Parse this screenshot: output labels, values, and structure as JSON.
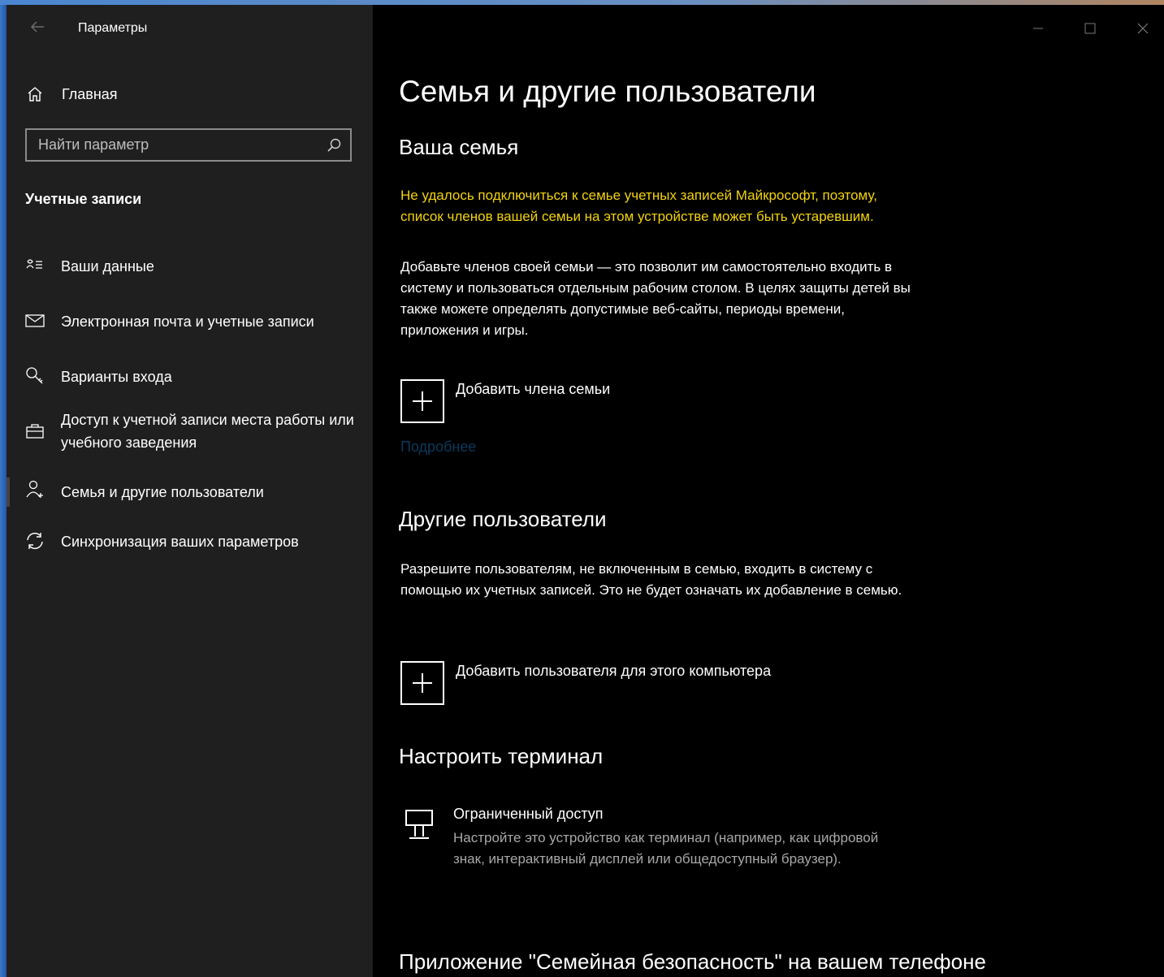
{
  "app": {
    "title": "Параметры"
  },
  "sidebar": {
    "home_label": "Главная",
    "search_placeholder": "Найти параметр",
    "section_title": "Учетные записи",
    "items": [
      {
        "label": "Ваши данные",
        "icon": "user-info-icon"
      },
      {
        "label": "Электронная почта и учетные записи",
        "icon": "mail-icon"
      },
      {
        "label": "Варианты входа",
        "icon": "key-icon"
      },
      {
        "label": "Доступ к учетной записи места работы или учебного заведения",
        "icon": "briefcase-icon"
      },
      {
        "label": "Семья и другие пользователи",
        "icon": "add-person-icon",
        "selected": true
      },
      {
        "label": "Синхронизация ваших параметров",
        "icon": "sync-icon"
      }
    ]
  },
  "main": {
    "page_title": "Семья и другие пользователи",
    "family": {
      "heading": "Ваша семья",
      "warning": "Не удалось подключиться к семье учетных записей Майкрософт, поэтому, список членов вашей семьи на этом устройстве может быть устаревшим.",
      "description": "Добавьте членов своей семьи — это позволит им самостоятельно входить в систему и пользоваться отдельным рабочим столом. В целях защиты детей вы также можете определять допустимые веб-сайты, периоды времени, приложения и игры.",
      "add_label": "Добавить члена семьи",
      "more_link": "Подробнее"
    },
    "others": {
      "heading": "Другие пользователи",
      "description": "Разрешите пользователям, не включенным в семью, входить в систему с помощью их учетных записей. Это не будет означать их добавление в семью.",
      "add_label": "Добавить пользователя для этого компьютера"
    },
    "kiosk": {
      "heading": "Настроить терминал",
      "title": "Ограниченный доступ",
      "description": "Настройте это устройство как терминал (например, как цифровой знак, интерактивный дисплей или общедоступный браузер)."
    },
    "family_app": {
      "heading": "Приложение \"Семейная безопасность\" на вашем телефоне"
    }
  },
  "colors": {
    "sidebar_bg": "#1f1f1f",
    "main_bg": "#000000",
    "warning": "#f2d20f",
    "link_disabled": "#0a3a5e",
    "secondary_text": "#a8a8a8"
  }
}
